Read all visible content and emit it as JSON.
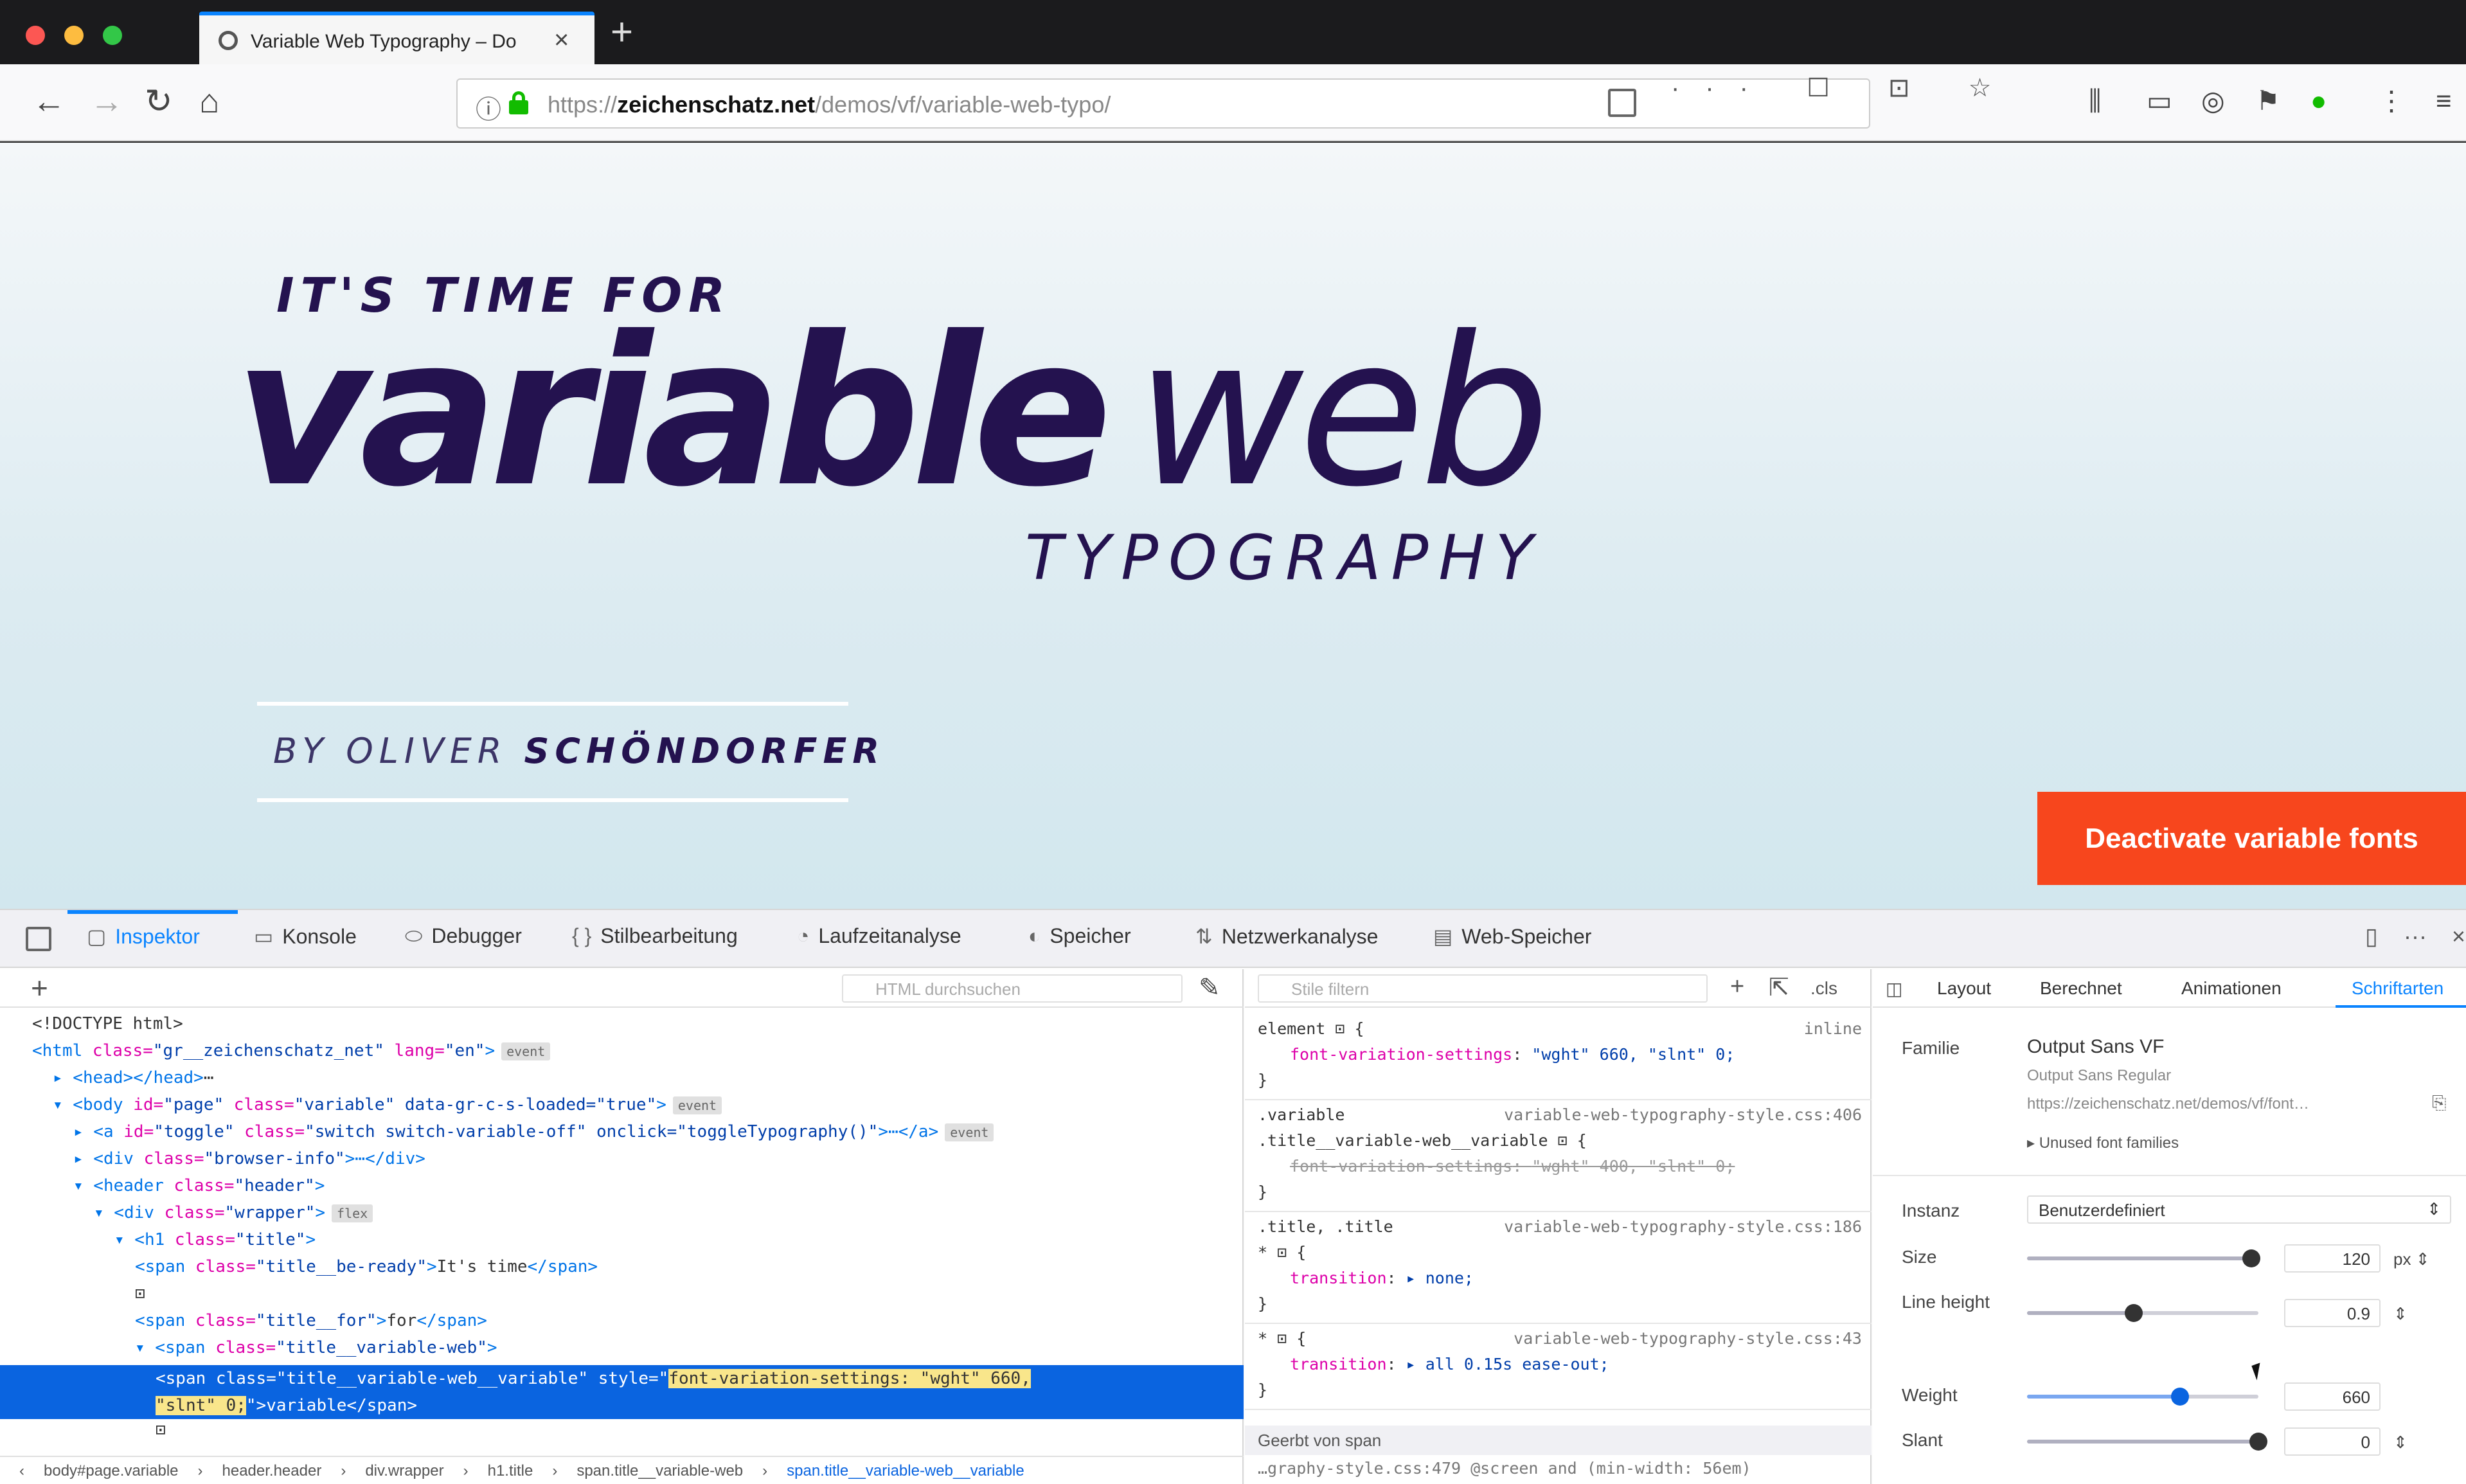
{
  "browser": {
    "tab_title": "Variable Web Typography – Do",
    "url_prefix": "https://",
    "url_domain": "zeichenschatz.net",
    "url_path": "/demos/vf/variable-web-typo/",
    "url_actions": "··· ☐ ⊡ ☆"
  },
  "page": {
    "line1": "IT'S TIME  FOR",
    "line2_bold": "variable",
    "line2_light": "web",
    "line3": "TYPOGRAPHY",
    "byline_prefix": "BY OLIVER ",
    "byline_name": "SCHÖNDORFER",
    "toggle_button": "Deactivate variable fonts"
  },
  "devtools": {
    "tabs": [
      {
        "label": "Inspektor",
        "icon": "▢"
      },
      {
        "label": "Konsole",
        "icon": "▭"
      },
      {
        "label": "Debugger",
        "icon": "⬭"
      },
      {
        "label": "Stilbearbeitung",
        "icon": "{ }"
      },
      {
        "label": "Laufzeitanalyse",
        "icon": "◔"
      },
      {
        "label": "Speicher",
        "icon": "◐"
      },
      {
        "label": "Netzwerkanalyse",
        "icon": "⇅"
      },
      {
        "label": "Web-Speicher",
        "icon": "▤"
      }
    ],
    "html_search_placeholder": "HTML durchsuchen",
    "rules_filter_placeholder": "Stile filtern",
    "markup": [
      {
        "indent": 0,
        "html": "<!DOCTYPE html>"
      },
      {
        "indent": 0,
        "tag": "<html",
        "attr1": " class=",
        "val1": "\"gr__zeichenschatz_net\"",
        "attr2": " lang=",
        "val2": "\"en\"",
        "end": ">",
        "badge": "event"
      },
      {
        "indent": 1,
        "tag": "▸ <head>",
        "txt": "⋯",
        "end": "</head>"
      },
      {
        "indent": 1,
        "tag": "▾ <body",
        "attr1": " id=",
        "val1": "\"page\"",
        "attr2": " class=",
        "val2": "\"variable\" data-gr-c-s-loaded=\"true\"",
        "end": ">",
        "badge": "event"
      },
      {
        "indent": 2,
        "tag": "▸ <a",
        "attr1": " id=",
        "val1": "\"toggle\"",
        "attr2": " class=",
        "val2": "\"switch switch-variable-off\" onclick=\"toggleTypography()\"",
        "end": ">⋯</a>",
        "badge": "event"
      },
      {
        "indent": 2,
        "tag": "▸ <div",
        "attr1": " class=",
        "val1": "\"browser-info\"",
        "end": ">⋯</div>"
      },
      {
        "indent": 2,
        "tag": "▾ <header",
        "attr1": " class=",
        "val1": "\"header\"",
        "end": ">"
      },
      {
        "indent": 3,
        "tag": "▾ <div",
        "attr1": " class=",
        "val1": "\"wrapper\"",
        "end": ">",
        "badge": "flex"
      },
      {
        "indent": 4,
        "tag": "▾ <h1",
        "attr1": " class=",
        "val1": "\"title\"",
        "end": ">"
      },
      {
        "indent": 5,
        "tag": "<span",
        "attr1": " class=",
        "val1": "\"title__be-ready\"",
        "end": ">",
        "txt": "It's time",
        "close": "</span>"
      },
      {
        "indent": 5,
        "txt": "⊡"
      },
      {
        "indent": 5,
        "tag": "<span",
        "attr1": " class=",
        "val1": "\"title__for\"",
        "end": ">",
        "txt": "for",
        "close": "</span>"
      },
      {
        "indent": 5,
        "tag": "▾ <span",
        "attr1": " class=",
        "val1": "\"title__variable-web\"",
        "end": ">"
      }
    ],
    "selected_line1_prefix": "<span class=\"title__variable-web__variable\" style=\"",
    "selected_line1_hl": "font-variation-settings: \"wght\" 660,",
    "selected_line2_hl": "\"slnt\" 0;",
    "selected_line2_suffix": "\">variable</span>",
    "breadcrumbs": [
      "body#page.variable",
      "header.header",
      "div.wrapper",
      "h1.title",
      "span.title__variable-web",
      "span.title__variable-web__variable"
    ],
    "rules": [
      {
        "kind": "sel",
        "text": "element ⊡ {",
        "src": "inline"
      },
      {
        "kind": "decl",
        "prop": "font-variation-settings",
        "val": "\"wght\" 660, \"slnt\" 0;"
      },
      {
        "kind": "close",
        "text": "}"
      },
      {
        "kind": "sel",
        "text": ".variable",
        "src": "variable-web-typography-style.css:406"
      },
      {
        "kind": "sel",
        "text": ".title__variable-web__variable ⊡ {"
      },
      {
        "kind": "decl",
        "prop": "font-variation-settings",
        "val": "\"wght\" 400, \"slnt\" 0;",
        "strike": true
      },
      {
        "kind": "close",
        "text": "}"
      },
      {
        "kind": "sel",
        "text": ".title, .title",
        "src": "variable-web-typography-style.css:186"
      },
      {
        "kind": "sel",
        "text": "* ⊡ {"
      },
      {
        "kind": "decl",
        "prop": "transition",
        "val": "▸ none;"
      },
      {
        "kind": "close",
        "text": "}"
      },
      {
        "kind": "sel",
        "text": "* ⊡ {",
        "src": "variable-web-typography-style.css:43"
      },
      {
        "kind": "decl",
        "prop": "transition",
        "val": "▸ all 0.15s ease-out;"
      },
      {
        "kind": "close",
        "text": "}"
      }
    ],
    "inherited_label": "Geerbt von span",
    "rules_footer": "…graphy-style.css:479 @screen and (min-width: 56em)",
    "font_tabs": [
      "Layout",
      "Berechnet",
      "Animationen",
      "Schriftarten"
    ],
    "fonts": {
      "family_label": "Familie",
      "family_name": "Output Sans VF",
      "family_sub": "Output Sans Regular",
      "family_url": "https://zeichenschatz.net/demos/vf/font…",
      "unused": "▸ Unused font families",
      "instance_label": "Instanz",
      "instance_value": "Benutzerdefiniert",
      "size_label": "Size",
      "size_value": "120",
      "size_unit": "px",
      "size_fraction": 0.97,
      "lh_label": "Line height",
      "lh_value": "0.9",
      "lh_fraction": 0.46,
      "weight_label": "Weight",
      "weight_value": "660",
      "weight_fraction": 0.66,
      "slant_label": "Slant",
      "slant_value": "0",
      "slant_fraction": 1.0
    }
  },
  "colors": {
    "hero": "#24124f",
    "accent_button": "#f7461d",
    "devtools_selected": "#0a64e0",
    "devtools_active_tab": "#0a84ff"
  }
}
